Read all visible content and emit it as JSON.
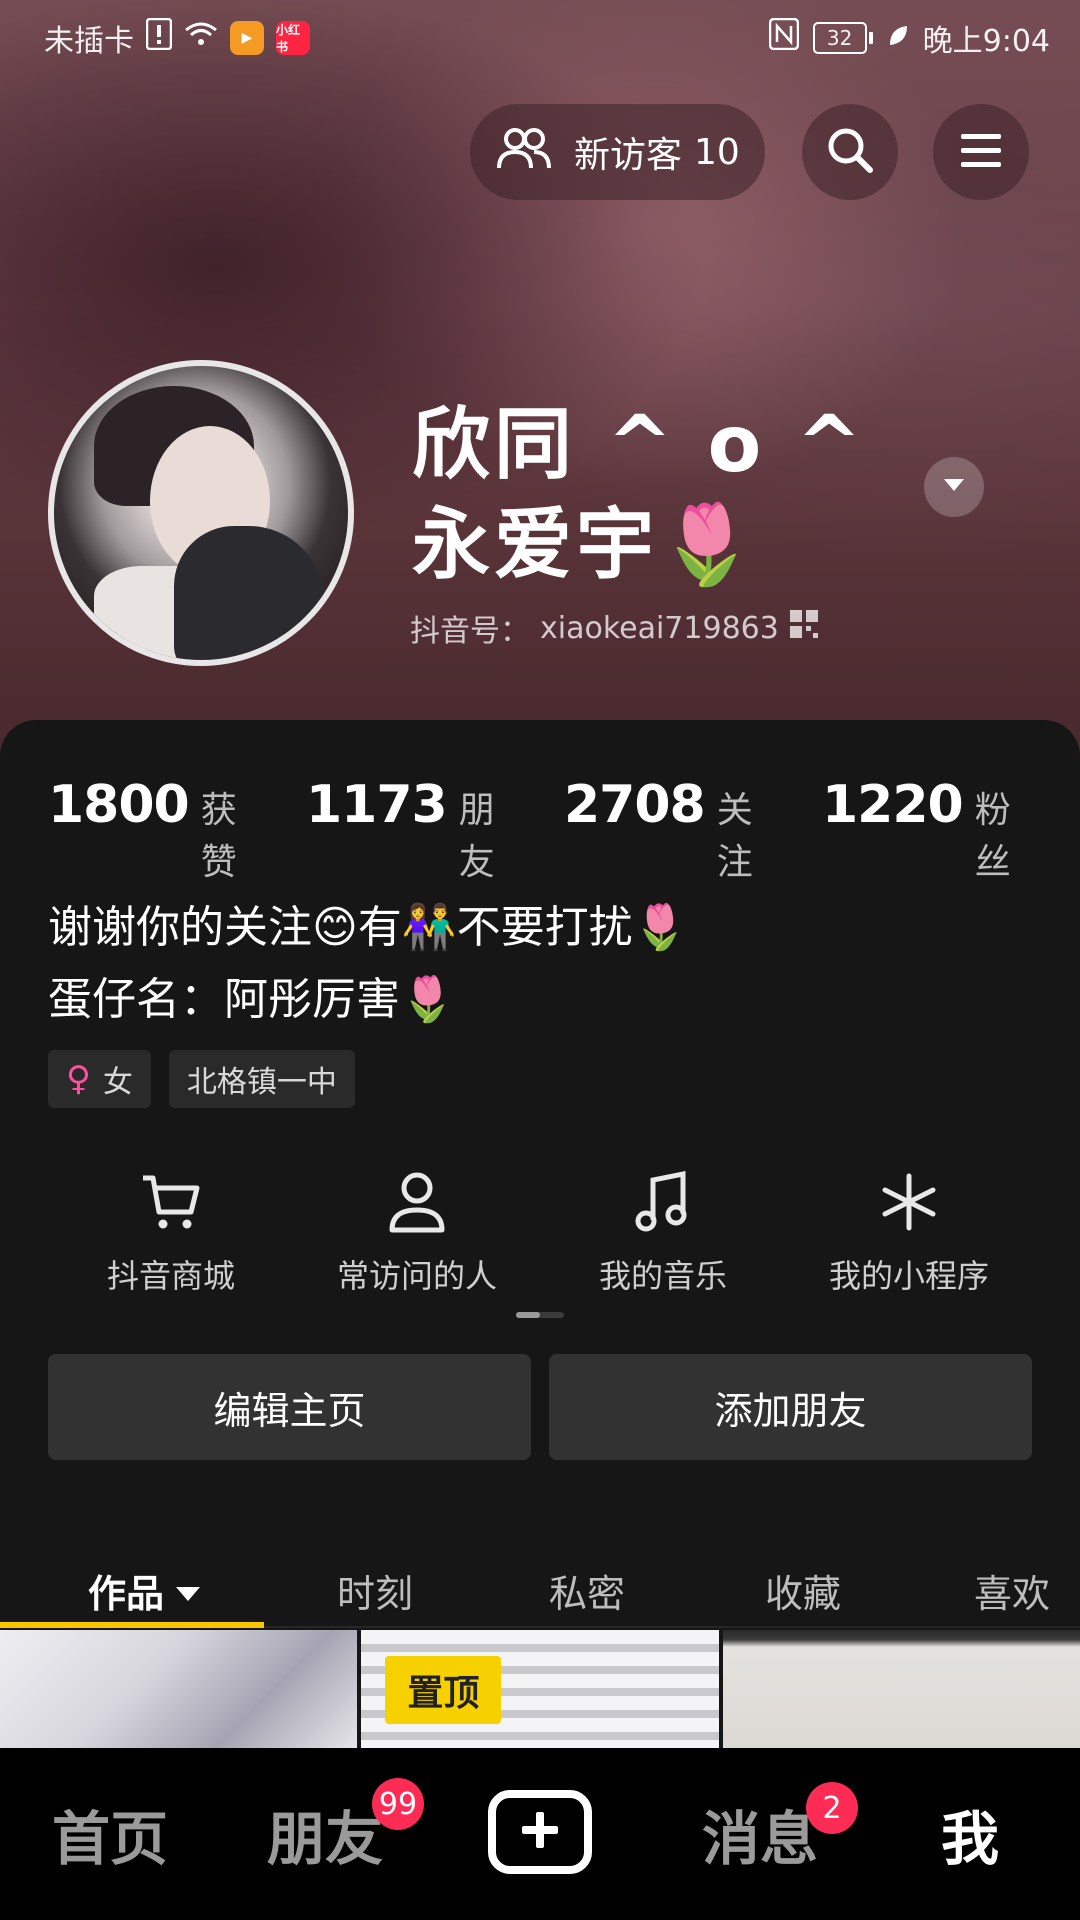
{
  "status_bar": {
    "carrier": "未插卡",
    "battery": "32",
    "time": "晚上9:04",
    "app1": "▶",
    "app2": "小红书"
  },
  "top_bar": {
    "visitor_label": "新访客",
    "visitor_count": "10"
  },
  "profile": {
    "nickname": "欣同 ^ o ^ 永爱宇🌷",
    "douyin_id_label": "抖音号：",
    "douyin_id": "xiaokeai719863"
  },
  "stats": [
    {
      "value": "1800",
      "label": "获赞"
    },
    {
      "value": "1173",
      "label": "朋友"
    },
    {
      "value": "2708",
      "label": "关注"
    },
    {
      "value": "1220",
      "label": "粉丝"
    }
  ],
  "bio": {
    "line1": "谢谢你的关注😊有👫不要打扰🌷",
    "line2": "蛋仔名：阿彤厉害🌷"
  },
  "tags": {
    "gender_symbol": "♀",
    "gender": "女",
    "school": "北格镇一中"
  },
  "services": [
    {
      "label": "抖音商城",
      "icon": "cart-icon"
    },
    {
      "label": "常访问的人",
      "icon": "person-icon"
    },
    {
      "label": "我的音乐",
      "icon": "music-icon"
    },
    {
      "label": "我的小程序",
      "icon": "asterisk-icon"
    }
  ],
  "actions": {
    "edit": "编辑主页",
    "add_friend": "添加朋友"
  },
  "tabs": [
    {
      "label": "作品"
    },
    {
      "label": "时刻"
    },
    {
      "label": "私密"
    },
    {
      "label": "收藏"
    },
    {
      "label": "喜欢"
    }
  ],
  "grid": {
    "pinned_label": "置顶"
  },
  "nav": {
    "home": "首页",
    "friends": "朋友",
    "friends_badge": "99",
    "messages": "消息",
    "messages_badge": "2",
    "me": "我"
  },
  "colors": {
    "accent": "#f7c600",
    "badge": "#fe2c55",
    "panel": "#161616"
  }
}
